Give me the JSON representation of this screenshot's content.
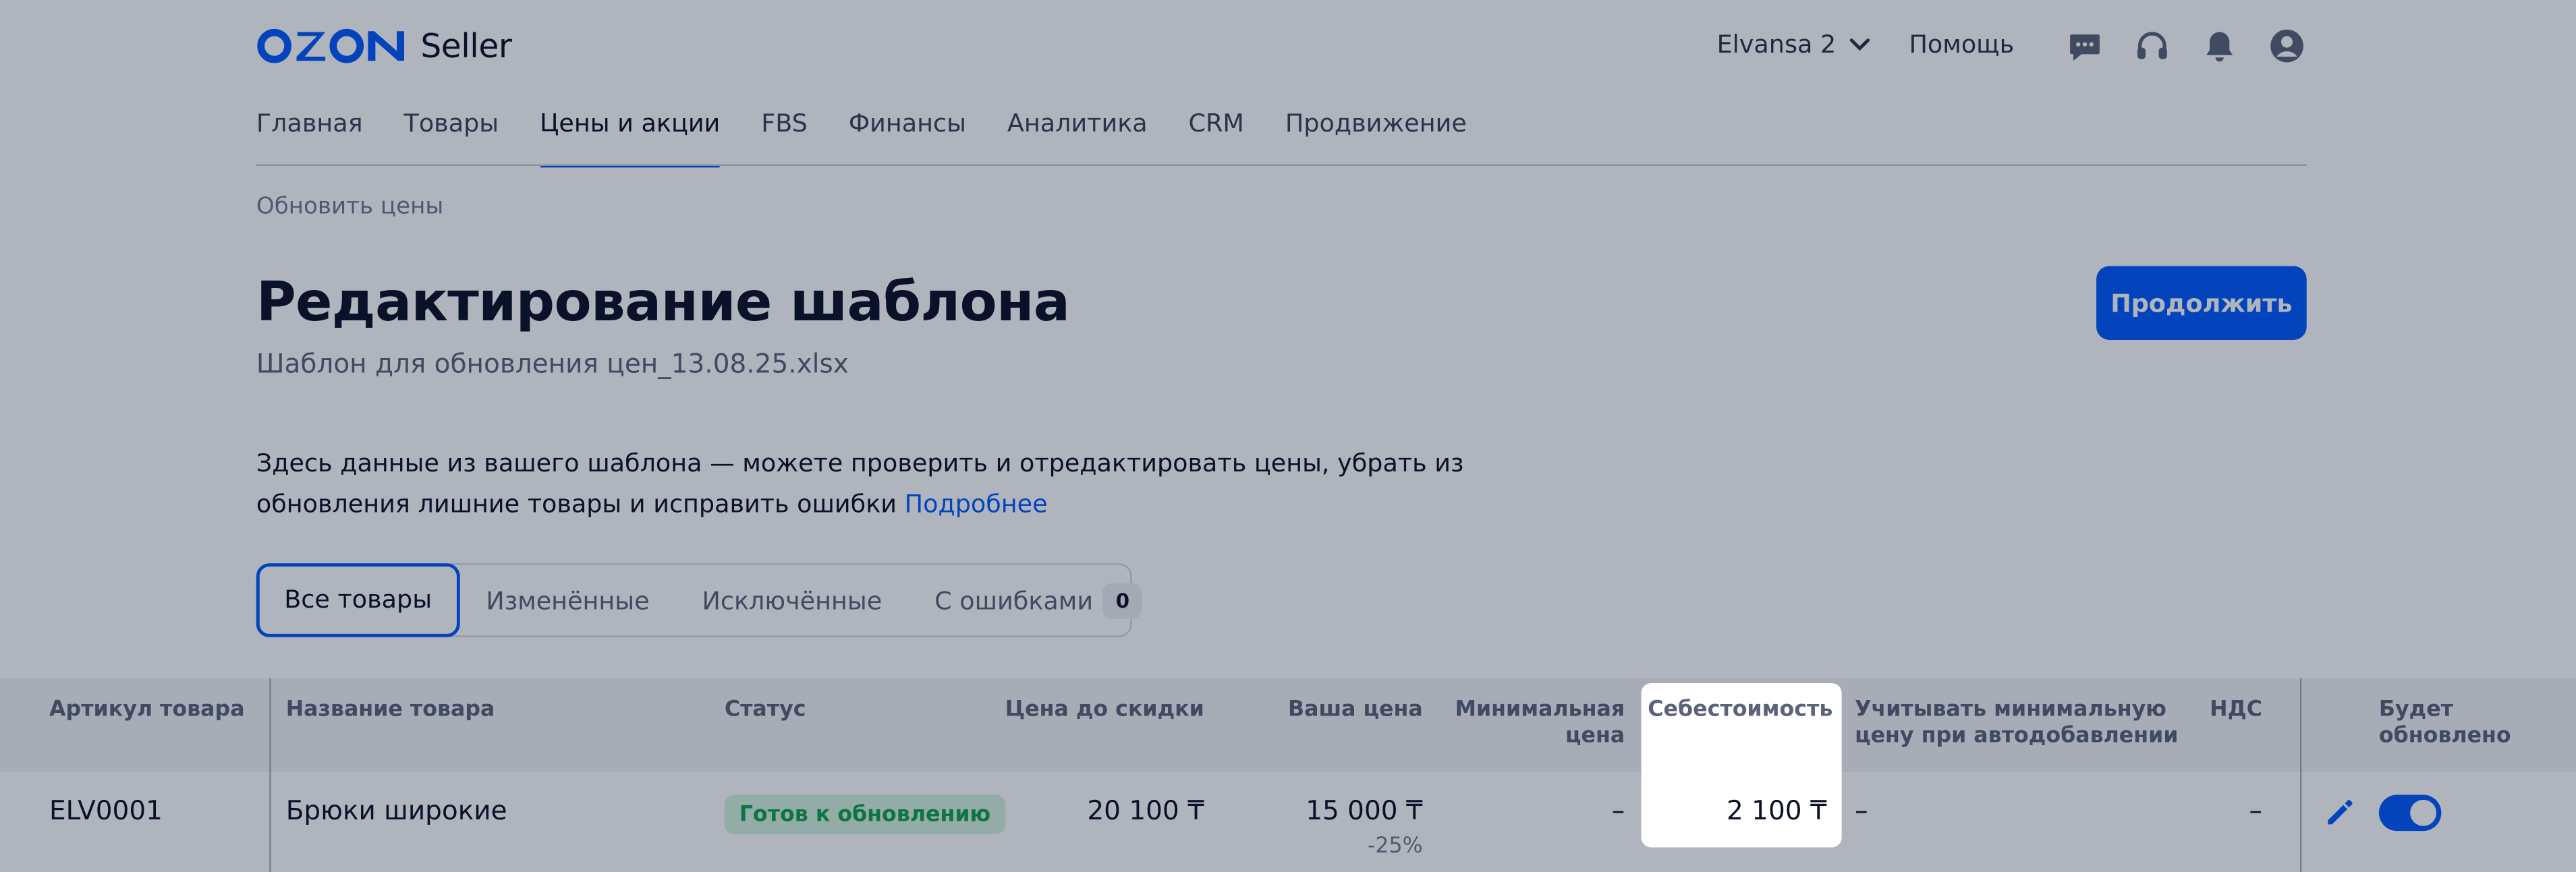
{
  "header": {
    "logo_text": "OZON",
    "logo_suffix": "Seller",
    "account_name": "Elvansa 2",
    "help_label": "Помощь",
    "icons": [
      "chat-icon",
      "headset-icon",
      "bell-icon",
      "profile-icon"
    ]
  },
  "nav": {
    "items": [
      "Главная",
      "Товары",
      "Цены и акции",
      "FBS",
      "Финансы",
      "Аналитика",
      "CRM",
      "Продвижение"
    ],
    "active": "Цены и акции"
  },
  "breadcrumb": "Обновить цены",
  "page": {
    "title": "Редактирование шаблона",
    "subtitle": "Шаблон для обновления цен_13.08.25.xlsx",
    "continue_label": "Продолжить",
    "info_text": "Здесь данные из вашего шаблона — можете проверить и отредактировать цены, убрать из обновления лишние товары и исправить ошибки",
    "info_link": "Подробнее"
  },
  "tabs": {
    "items": [
      {
        "label": "Все товары"
      },
      {
        "label": "Изменённые"
      },
      {
        "label": "Исключённые"
      },
      {
        "label": "С ошибками",
        "count": "0"
      }
    ],
    "active": "Все товары"
  },
  "table": {
    "columns": {
      "article": "Артикул товара",
      "name": "Название товара",
      "status": "Статус",
      "price_before": "Цена до скидки",
      "your_price": "Ваша цена",
      "min_price_1": "Минимальная",
      "min_price_2": "цена",
      "cost": "Себестоимость",
      "consider_min_1": "Учитывать минимальную",
      "consider_min_2": "цену при автодобавлении",
      "vat": "НДС",
      "will_update_1": "Будет",
      "will_update_2": "обновлено"
    },
    "rows": [
      {
        "article": "ELV0001",
        "name": "Брюки широкие",
        "status": "Готов к обновлению",
        "price_before": "20 100 ₸",
        "your_price": "15 000 ₸",
        "discount": "-25%",
        "min_price": "–",
        "cost": "2 100 ₸",
        "consider_min": "–",
        "vat": "–",
        "will_update": true
      }
    ]
  },
  "colors": {
    "accent": "#005bff",
    "status_green": "#10a24a",
    "status_green_bg": "#d6f3e0",
    "overlay": "rgba(10,23,51,0.32)"
  }
}
